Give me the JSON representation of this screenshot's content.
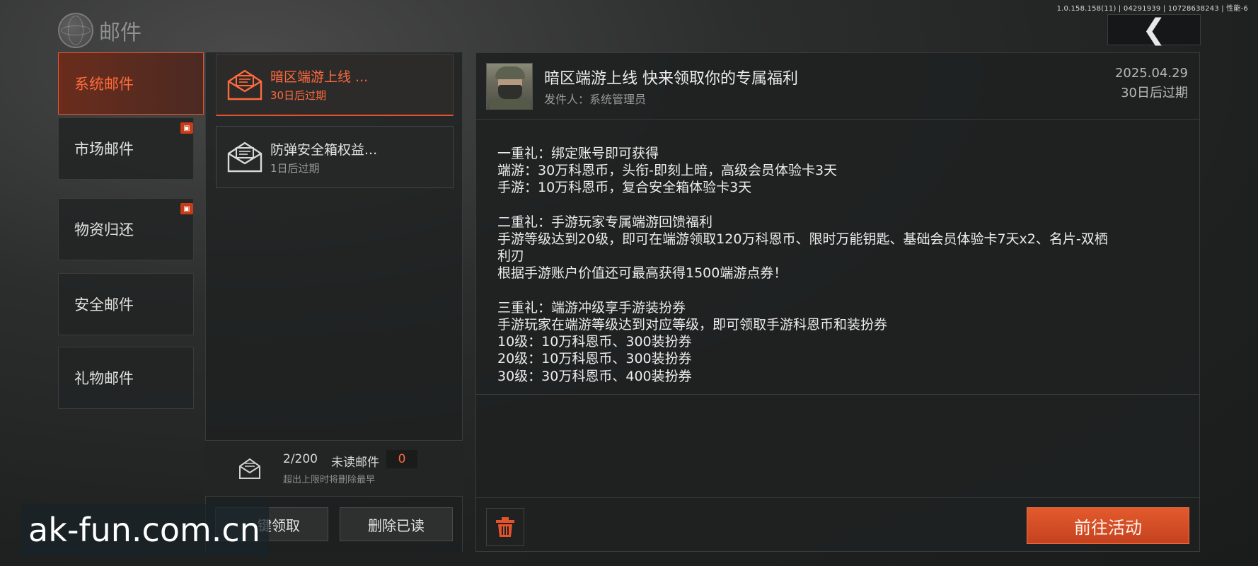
{
  "status_bar": {
    "version_text": "1.0.158.158(11) | 04291939 | 10728638243 | 性能-6"
  },
  "header": {
    "title": "邮件",
    "icons": {
      "logo": "globe-icon",
      "back": "back-arrow-icon"
    }
  },
  "categories": [
    {
      "label": "系统邮件",
      "active": true,
      "badge": false
    },
    {
      "label": "市场邮件",
      "active": false,
      "badge": true
    },
    {
      "label": "物资归还",
      "active": false,
      "badge": true
    },
    {
      "label": "安全邮件",
      "active": false,
      "badge": false
    },
    {
      "label": "礼物邮件",
      "active": false,
      "badge": false
    }
  ],
  "mail_list": [
    {
      "title": "暗区端游上线 ...",
      "expire": "30日后过期",
      "active": true,
      "icon": "envelope-open-icon"
    },
    {
      "title": "防弹安全箱权益...",
      "expire": "1日后过期",
      "active": false,
      "icon": "envelope-open-icon"
    }
  ],
  "quota": {
    "count": "2/200",
    "unread_label": "未读邮件",
    "unread_count": "0",
    "hint": "超出上限时将删除最早"
  },
  "list_actions": {
    "claim_all": "一键领取",
    "delete_read": "删除已读"
  },
  "detail": {
    "title": "暗区端游上线 快来领取你的专属福利",
    "sender": "发件人：系统管理员",
    "date": "2025.04.29",
    "expire": "30日后过期",
    "body_lines": [
      "一重礼：绑定账号即可获得",
      "端游：30万科恩币，头衔-即刻上暗，高级会员体验卡3天",
      "手游：10万科恩币，复合安全箱体验卡3天",
      "",
      "二重礼：手游玩家专属端游回馈福利",
      "手游等级达到20级，即可在端游领取120万科恩币、限时万能钥匙、基础会员体验卡7天x2、名片-双栖",
      "利刃",
      "根据手游账户价值还可最高获得1500端游点券！",
      "",
      "三重礼：端游冲级享手游装扮券",
      "手游玩家在端游等级达到对应等级，即可领取手游科恩币和装扮券",
      "10级：10万科恩币、300装扮券",
      "20级：10万科恩币、300装扮券",
      "30级：30万科恩币、400装扮券"
    ],
    "goto_label": "前往活动"
  },
  "watermark": "ak-fun.com.cn",
  "colors": {
    "accent": "#e4532c",
    "accent_text": "#ff6a3c",
    "panel": "#1f2121"
  }
}
